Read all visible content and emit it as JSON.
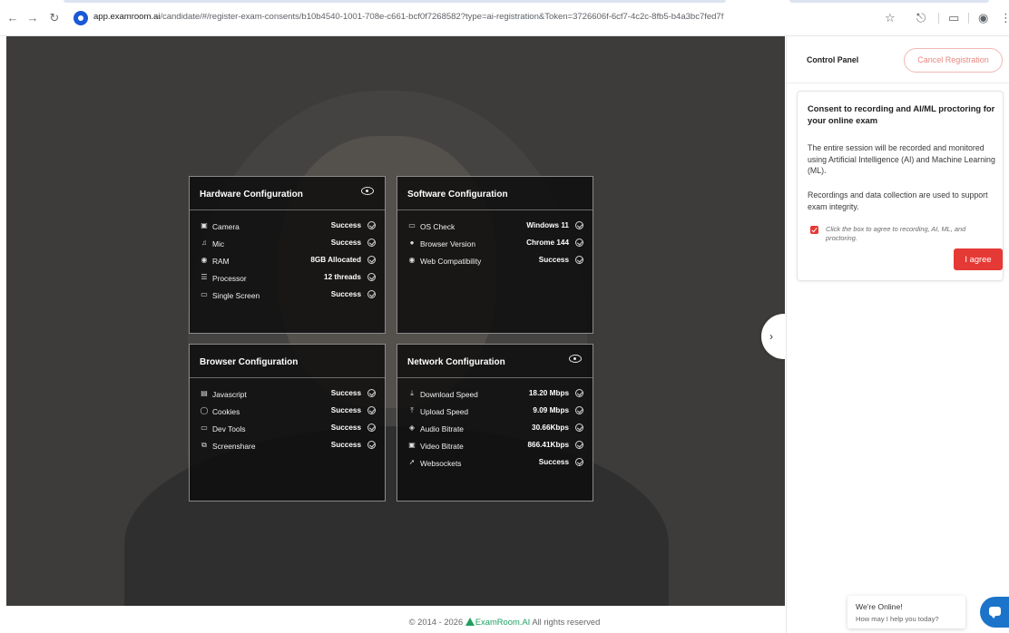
{
  "browser": {
    "url_host": "app.examroom.ai",
    "url_path": "/candidate/#/register-exam-consents/b10b4540-1001-708e-c661-bcf0f7268582?type=ai-registration&Token=3726606f-6cf7-4c2c-8fb5-b4a3bc7fed7f"
  },
  "hardware": {
    "title": "Hardware Configuration",
    "rows": [
      {
        "icon": "camera-icon",
        "label": "Camera",
        "value": "Success"
      },
      {
        "icon": "mic-icon",
        "label": "Mic",
        "value": "Success"
      },
      {
        "icon": "ram-icon",
        "label": "RAM",
        "value": "8GB Allocated"
      },
      {
        "icon": "processor-icon",
        "label": "Processor",
        "value": "12 threads"
      },
      {
        "icon": "screen-icon",
        "label": "Single Screen",
        "value": "Success"
      }
    ]
  },
  "software": {
    "title": "Software Configuration",
    "rows": [
      {
        "icon": "monitor-icon",
        "label": "OS Check",
        "value": "Windows 11"
      },
      {
        "icon": "browser-icon",
        "label": "Browser Version",
        "value": "Chrome 144"
      },
      {
        "icon": "globe-icon",
        "label": "Web Compatibility",
        "value": "Success"
      }
    ]
  },
  "browser_cfg": {
    "title": "Browser Configuration",
    "rows": [
      {
        "icon": "code-icon",
        "label": "Javascript",
        "value": "Success"
      },
      {
        "icon": "cookie-icon",
        "label": "Cookies",
        "value": "Success"
      },
      {
        "icon": "devtools-icon",
        "label": "Dev Tools",
        "value": "Success"
      },
      {
        "icon": "screenshare-icon",
        "label": "Screenshare",
        "value": "Success"
      }
    ]
  },
  "network": {
    "title": "Network Configuration",
    "rows": [
      {
        "icon": "download-icon",
        "label": "Download Speed",
        "value": "18.20 Mbps"
      },
      {
        "icon": "upload-icon",
        "label": "Upload Speed",
        "value": "9.09 Mbps"
      },
      {
        "icon": "audio-icon",
        "label": "Audio Bitrate",
        "value": "30.66Kbps"
      },
      {
        "icon": "video-icon",
        "label": "Video Bitrate",
        "value": "866.41Kbps"
      },
      {
        "icon": "websocket-icon",
        "label": "Websockets",
        "value": "Success"
      }
    ]
  },
  "control_panel": {
    "title": "Control Panel",
    "cancel_label": "Cancel Registration",
    "consent_title": "Consent to recording and AI/ML proctoring for your online exam",
    "consent_p1": "The entire session will be recorded and monitored using Artificial Intelligence (AI) and Machine Learning (ML).",
    "consent_p2": "Recordings and data collection are used to support exam integrity.",
    "agree_text": "Click the box to agree to recording, AI, ML, and proctoring.",
    "agree_label": "I agree"
  },
  "chat": {
    "line1": "We're Online!",
    "line2": "How may I help you today?"
  },
  "footer": {
    "copyright": "© 2014 - 2026",
    "brand": "ExamRoom.AI",
    "rights": "All rights reserved"
  },
  "colors": {
    "accent": "#e53935",
    "brand_green": "#1e9f62"
  }
}
